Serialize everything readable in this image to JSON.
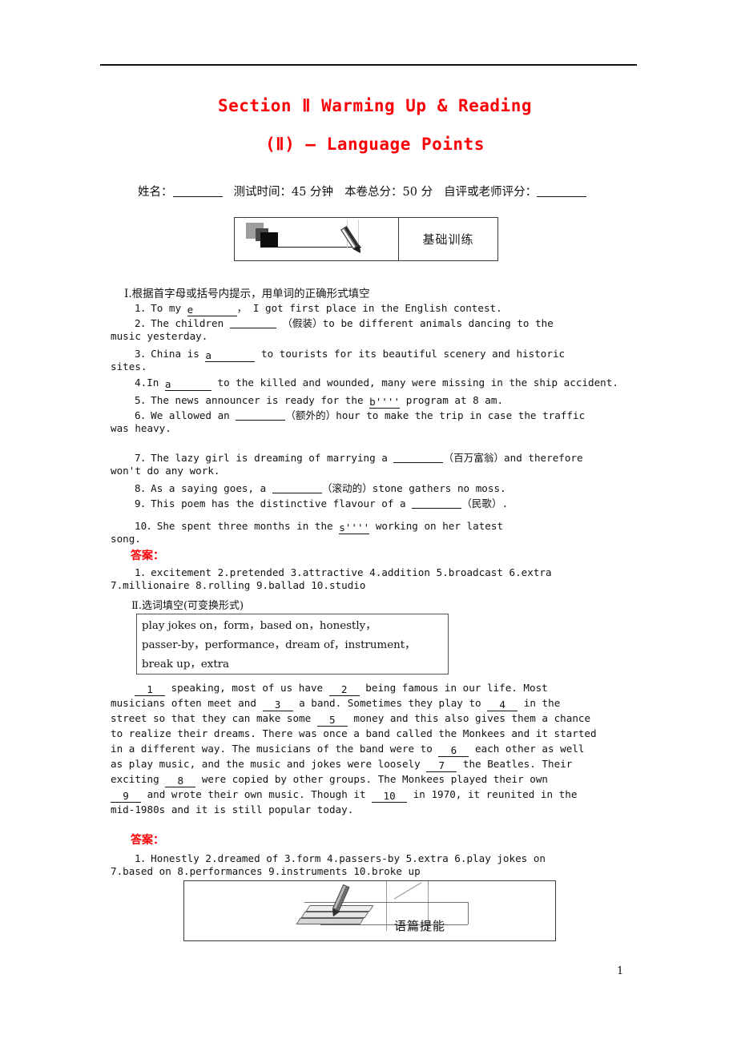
{
  "header": {
    "title_line1": "Section Ⅱ  Warming Up & Reading",
    "title_line2": "(Ⅱ) — Language Points",
    "title_color": "#fb0007",
    "info": {
      "name_label": "姓名：",
      "time_label": "测试时间：45 分钟",
      "total_label": "本卷总分：50 分",
      "score_label": "自评或老师评分："
    },
    "badge": {
      "label": "基础训练",
      "icon": "pencil-writing-icon"
    }
  },
  "section1": {
    "heading": "Ⅰ.根据首字母或括号内提示，用单词的正确形式填空",
    "items": [
      {
        "num": "1.",
        "pre": "To my ",
        "hint": "e",
        "post": "，  I got first place in the English contest."
      },
      {
        "num": "2.",
        "pre": "The children ",
        "hint": "",
        "post": "（假装）to be different animals  dancing to the"
      },
      {
        "num": "",
        "cont": "music yesterday."
      },
      {
        "num": "3.",
        "pre": "China is   ",
        "hint": "a",
        "post": "to tourists for its beautiful scenery  and historic"
      },
      {
        "num": "",
        "cont": "sites."
      },
      {
        "num": "4.",
        "pre": "In ",
        "hint": "a",
        "post": "to the killed and wounded, many were  missing in the ship accident."
      },
      {
        "num": "5.",
        "pre": "The news announcer is ready for the ",
        "hint": "b''''",
        "post": "program at 8 am."
      },
      {
        "num": "6.",
        "pre": "We allowed an  ",
        "hint": "",
        "post": "（额外的）hour to make the  trip in case the traffic"
      },
      {
        "num": "",
        "cont": "was heavy."
      },
      {
        "num": "7.",
        "pre": "The lazy girl is dreaming of marrying a ",
        "hint": "",
        "post": "（百万富翁）and therefore"
      },
      {
        "num": "",
        "cont": "won't do any work."
      },
      {
        "num": "8.",
        "pre": "As a saying goes, a ",
        "hint": "",
        "post": "（滚动的）stone gathers    no moss."
      },
      {
        "num": "9.",
        "pre": "This poem has the distinctive flavour of a ",
        "hint": "",
        "post": "（民歌）."
      },
      {
        "num": "10.",
        "pre": "She spent three months in the ",
        "hint": "s''''",
        "post": "working on   her latest"
      },
      {
        "num": "",
        "cont": "song."
      }
    ],
    "answer_label": "答案：",
    "answers_line1": "1．excitement  2.pretended  3.attractive  4.addition  5.broadcast  6.extra",
    "answers_line2": "7.millionaire  8.rolling  9.ballad  10.studio"
  },
  "section2": {
    "heading": "Ⅱ.选词填空(可变换形式)",
    "wordbank": [
      "play jokes on，form，based on，honestly，",
      "passer-by，performance，dream of，instrument，",
      "break up，extra"
    ],
    "passage_lines": [
      "__1__  speaking, most of us have  __2__   being famous in our life. Most",
      "musicians often meet and  __3__ a band. Sometimes they play to  __4__   in the",
      "street so that they can make some  __5__   money and this also gives them a chance",
      "to realize their dreams. There was once a band called the Monkees and it started",
      "in a different way.  The musicians of the band were to  __6__   each other as well",
      "as play music, and the music and jokes were loosely  __7__   the Beatles.  Their",
      "exciting  __8__   were copied by other groups.  The Monkees played their own",
      "__9__   and wrote their own music. Though it  __10__   in 1970, it reunited in the",
      "mid-1980s and it is still popular today."
    ],
    "answer_label": "答案：",
    "answers_line1": "1．Honestly  2.dreamed of  3.form  4.passers-by  5.extra  6.play jokes on",
    "answers_line2": "7.based on  8.performances  9.instruments  10.broke up"
  },
  "footer_badge": {
    "label": "语篇提能",
    "icon": "book-pencil-icon"
  },
  "page_number": "1"
}
